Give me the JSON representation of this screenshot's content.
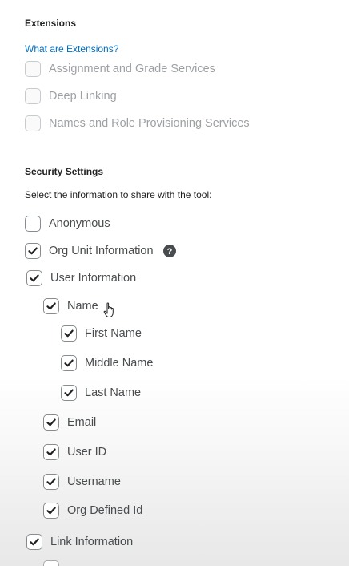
{
  "extensions": {
    "title": "Extensions",
    "link": "What are Extensions?",
    "items": [
      {
        "label": "Assignment and Grade Services",
        "checked": false,
        "disabled": true
      },
      {
        "label": "Deep Linking",
        "checked": false,
        "disabled": true
      },
      {
        "label": "Names and Role Provisioning Services",
        "checked": false,
        "disabled": true
      }
    ]
  },
  "security": {
    "title": "Security Settings",
    "helper": "Select the information to share with the tool:",
    "anonymous": {
      "label": "Anonymous",
      "checked": false
    },
    "org_unit": {
      "label": "Org Unit Information",
      "checked": true,
      "help_icon": "question-circle-icon"
    },
    "user_info": {
      "label": "User Information",
      "checked": true
    },
    "name": {
      "label": "Name",
      "checked": true
    },
    "first_name": {
      "label": "First Name",
      "checked": true
    },
    "middle_name": {
      "label": "Middle Name",
      "checked": true
    },
    "last_name": {
      "label": "Last Name",
      "checked": true
    },
    "email": {
      "label": "Email",
      "checked": true
    },
    "user_id": {
      "label": "User ID",
      "checked": true
    },
    "username": {
      "label": "Username",
      "checked": true
    },
    "org_defined_id": {
      "label": "Org Defined Id",
      "checked": true
    },
    "link_info": {
      "label": "Link Information",
      "checked": true
    }
  },
  "colors": {
    "link": "#006fbf",
    "text": "#494c4e",
    "heading": "#202122",
    "disabled_text": "#9da1a4",
    "checkbox_border": "#868c8f"
  }
}
